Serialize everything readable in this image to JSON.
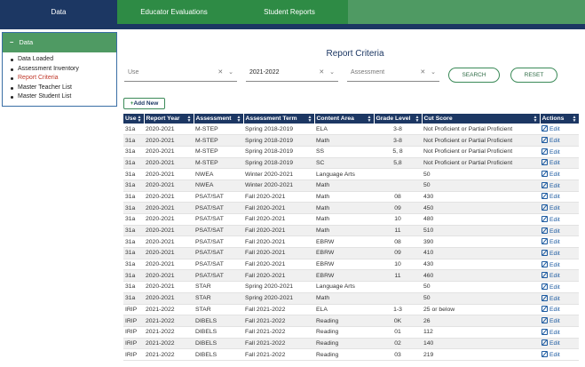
{
  "nav": {
    "tabs": [
      {
        "label": "Data"
      },
      {
        "label": "Educator Evaluations"
      },
      {
        "label": "Student Reports"
      }
    ]
  },
  "sidebar": {
    "title": "Data",
    "items": [
      {
        "label": "Data Loaded"
      },
      {
        "label": "Assessment Inventory"
      },
      {
        "label": "Report Criteria"
      },
      {
        "label": "Master Teacher List"
      },
      {
        "label": "Master Student List"
      }
    ],
    "active_index": 2
  },
  "page": {
    "title": "Report Criteria"
  },
  "filters": {
    "use_placeholder": "Use",
    "year_value": "2021-2022",
    "assessment_placeholder": "Assessment"
  },
  "buttons": {
    "search": "SEARCH",
    "reset": "RESET",
    "add_new": "Add New"
  },
  "table": {
    "columns": [
      "Use",
      "Report Year",
      "Assessment",
      "Assessment Term",
      "Content Area",
      "Grade Level",
      "Cut Score",
      "Actions"
    ],
    "edit_label": "Edit",
    "rows": [
      [
        "31a",
        "2020-2021",
        "M-STEP",
        "Spring 2018-2019",
        "ELA",
        "3-8",
        "Not Proficient or Partial Proficient"
      ],
      [
        "31a",
        "2020-2021",
        "M-STEP",
        "Spring 2018-2019",
        "Math",
        "3-8",
        "Not Proficient or Partial Proficient"
      ],
      [
        "31a",
        "2020-2021",
        "M-STEP",
        "Spring 2018-2019",
        "SS",
        "5, 8",
        "Not Proficient or Partial Proficient"
      ],
      [
        "31a",
        "2020-2021",
        "M-STEP",
        "Spring 2018-2019",
        "SC",
        "5,8",
        "Not Proficient or Partial Proficient"
      ],
      [
        "31a",
        "2020-2021",
        "NWEA",
        "Winter 2020-2021",
        "Language Arts",
        "",
        "50"
      ],
      [
        "31a",
        "2020-2021",
        "NWEA",
        "Winter 2020-2021",
        "Math",
        "",
        "50"
      ],
      [
        "31a",
        "2020-2021",
        "PSAT/SAT",
        "Fall 2020-2021",
        "Math",
        "08",
        "430"
      ],
      [
        "31a",
        "2020-2021",
        "PSAT/SAT",
        "Fall 2020-2021",
        "Math",
        "09",
        "450"
      ],
      [
        "31a",
        "2020-2021",
        "PSAT/SAT",
        "Fall 2020-2021",
        "Math",
        "10",
        "480"
      ],
      [
        "31a",
        "2020-2021",
        "PSAT/SAT",
        "Fall 2020-2021",
        "Math",
        "11",
        "510"
      ],
      [
        "31a",
        "2020-2021",
        "PSAT/SAT",
        "Fall 2020-2021",
        "EBRW",
        "08",
        "390"
      ],
      [
        "31a",
        "2020-2021",
        "PSAT/SAT",
        "Fall 2020-2021",
        "EBRW",
        "09",
        "410"
      ],
      [
        "31a",
        "2020-2021",
        "PSAT/SAT",
        "Fall 2020-2021",
        "EBRW",
        "10",
        "430"
      ],
      [
        "31a",
        "2020-2021",
        "PSAT/SAT",
        "Fall 2020-2021",
        "EBRW",
        "11",
        "460"
      ],
      [
        "31a",
        "2020-2021",
        "STAR",
        "Spring 2020-2021",
        "Language Arts",
        "",
        "50"
      ],
      [
        "31a",
        "2020-2021",
        "STAR",
        "Spring 2020-2021",
        "Math",
        "",
        "50"
      ],
      [
        "IRIP",
        "2021-2022",
        "STAR",
        "Fall 2021-2022",
        "ELA",
        "1-3",
        "25 or below"
      ],
      [
        "IRIP",
        "2021-2022",
        "DIBELS",
        "Fall 2021-2022",
        "Reading",
        "0K",
        "26"
      ],
      [
        "IRIP",
        "2021-2022",
        "DIBELS",
        "Fall 2021-2022",
        "Reading",
        "01",
        "112"
      ],
      [
        "IRIP",
        "2021-2022",
        "DIBELS",
        "Fall 2021-2022",
        "Reading",
        "02",
        "140"
      ],
      [
        "IRIP",
        "2021-2022",
        "DIBELS",
        "Fall 2021-2022",
        "Reading",
        "03",
        "219"
      ]
    ]
  }
}
